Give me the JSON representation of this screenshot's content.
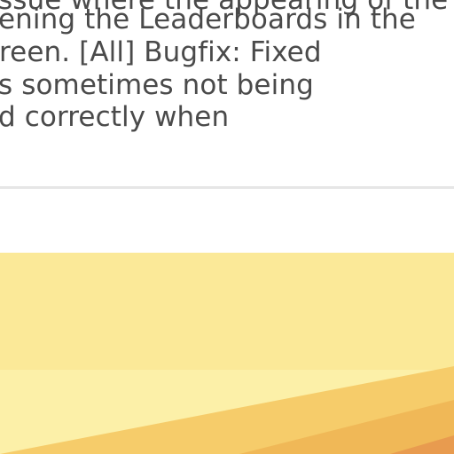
{
  "changelog": {
    "lines": [
      "ssue where the appearing of the",
      "ening the Leaderboards in the",
      "reen. [All] Bugfix: Fixed",
      "s sometimes not being",
      "d correctly when"
    ]
  },
  "banner": {
    "colors": {
      "top": "#fbe998",
      "middle": "#fcf0a8",
      "band": "#f6cc6a",
      "warm": "#f0b857",
      "deep": "#e89b4f"
    }
  }
}
